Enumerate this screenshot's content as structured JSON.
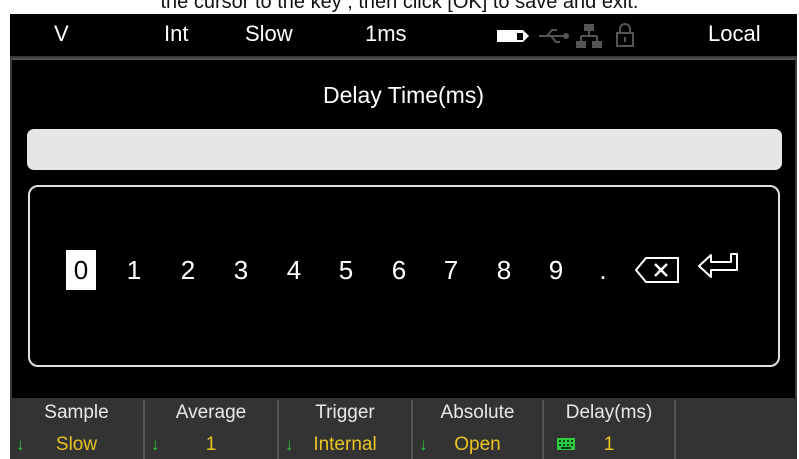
{
  "top_caption": "the cursor to the key , then click [OK] to save and exit.",
  "status_bar": {
    "mode": "V",
    "trigger_source": "Int",
    "speed": "Slow",
    "delay": "1ms",
    "remote": "Local",
    "icons": [
      "memory-card-icon",
      "usb-icon",
      "network-icon",
      "lock-icon"
    ]
  },
  "dialog": {
    "title": "Delay Time(ms)",
    "input_value": "",
    "keys": [
      "0",
      "1",
      "2",
      "3",
      "4",
      "5",
      "6",
      "7",
      "8",
      "9",
      "."
    ],
    "selected_key": "0",
    "backspace_icon": "backspace-icon",
    "enter_icon": "enter-icon"
  },
  "soft_keys": [
    {
      "label": "Sample",
      "value": "Slow",
      "icon": "arrow-down-icon"
    },
    {
      "label": "Average",
      "value": "1",
      "icon": "arrow-down-icon"
    },
    {
      "label": "Trigger",
      "value": "Internal",
      "icon": "arrow-down-icon"
    },
    {
      "label": "Absolute",
      "value": "Open",
      "icon": "arrow-down-icon"
    },
    {
      "label": "Delay(ms)",
      "value": "1",
      "icon": "keypad-icon"
    }
  ],
  "colors": {
    "value_text": "#e8c320",
    "arrow": "#2ecc40",
    "panel_bg": "#000000",
    "soft_bar_bg": "#333333"
  }
}
